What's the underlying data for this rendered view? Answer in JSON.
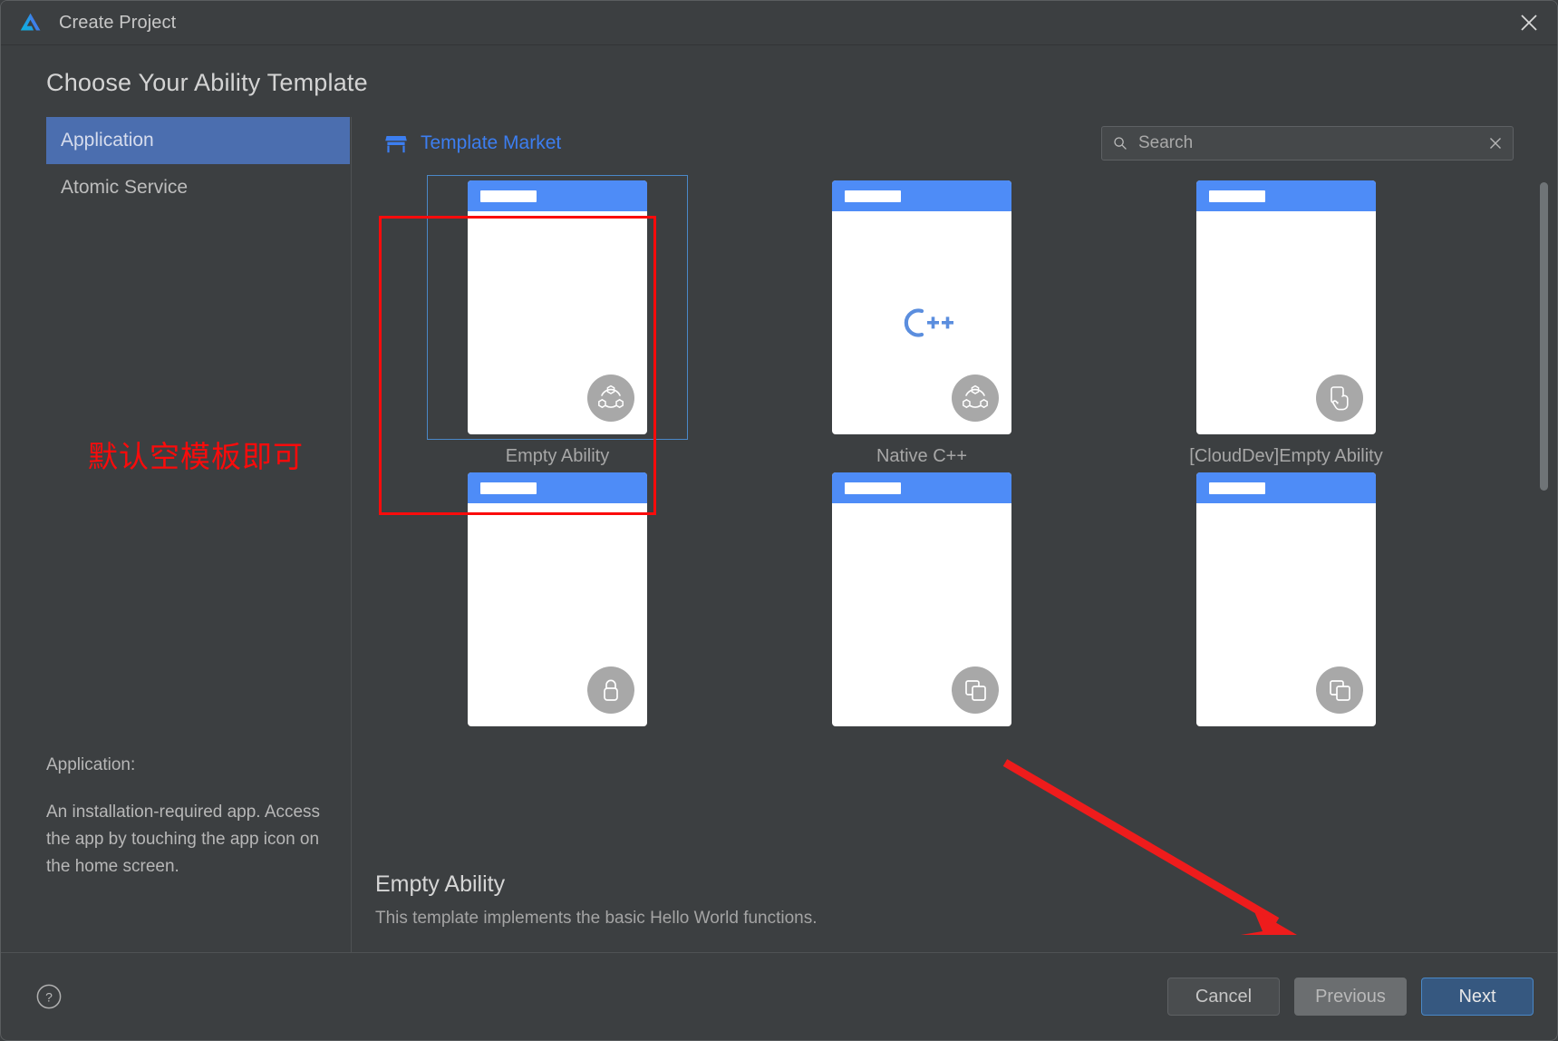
{
  "window": {
    "title": "Create Project",
    "close_icon": "close-icon",
    "logo_icon": "deveco-logo-icon"
  },
  "heading": "Choose Your Ability Template",
  "sidebar": {
    "items": [
      {
        "label": "Application",
        "selected": true
      },
      {
        "label": "Atomic Service",
        "selected": false
      }
    ],
    "description": {
      "title": "Application:",
      "body": "An installation-required app. Access the app by touching the app icon on the home screen."
    }
  },
  "annotations": {
    "chinese_note": "默认空模板即可",
    "note_color": "#fb0b0b",
    "highlight_box_color": "#fb0b0b",
    "arrow_color": "#ee1c1c"
  },
  "market": {
    "label": "Template Market",
    "icon": "storefront-icon",
    "color": "#3c7ef0"
  },
  "search": {
    "placeholder": "Search",
    "value": "",
    "icon": "search-icon",
    "clear_icon": "close-icon"
  },
  "templates": [
    {
      "label": "Empty Ability",
      "icon": "share-nodes-icon",
      "selected": true
    },
    {
      "label": "Native C++",
      "icon": "share-nodes-icon",
      "logo": "cpp-logo",
      "selected": false
    },
    {
      "label": "[CloudDev]Empty Ability",
      "icon": "hand-tap-icon",
      "selected": false
    },
    {
      "label": "",
      "icon": "lock-icon",
      "selected": false
    },
    {
      "label": "",
      "icon": "copy-pages-icon",
      "selected": false
    },
    {
      "label": "",
      "icon": "copy-pages-icon",
      "selected": false
    }
  ],
  "detail": {
    "title": "Empty Ability",
    "description": "This template implements the basic Hello World functions."
  },
  "footer": {
    "help_icon": "help-circle-icon",
    "cancel_label": "Cancel",
    "previous_label": "Previous",
    "next_label": "Next",
    "next_color": "#365880"
  }
}
